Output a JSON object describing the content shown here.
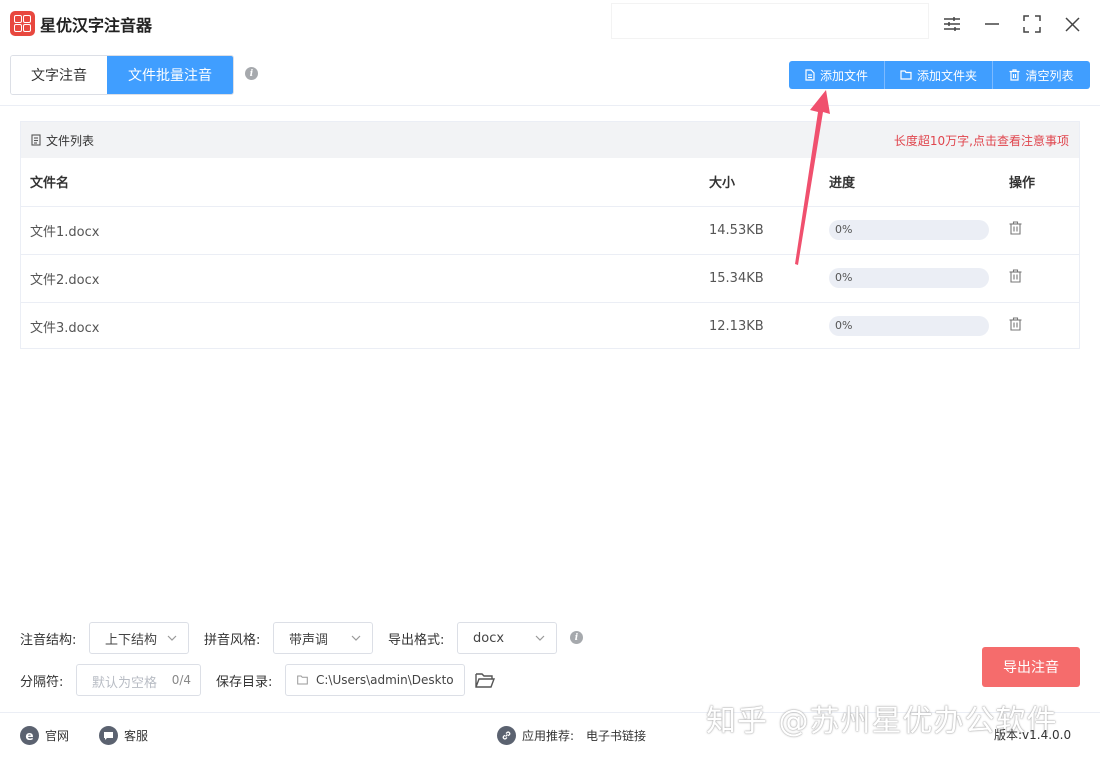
{
  "app": {
    "title": "星优汉字注音器"
  },
  "mode_tabs": [
    {
      "label": "文字注音",
      "active": false
    },
    {
      "label": "文件批量注音",
      "active": true
    }
  ],
  "toolbar": {
    "add_file": "添加文件",
    "add_folder": "添加文件夹",
    "clear_list": "清空列表"
  },
  "file_list": {
    "title": "文件列表",
    "note": "长度超10万字,点击查看注意事项",
    "columns": [
      "文件名",
      "大小",
      "进度",
      "操作"
    ],
    "rows": [
      {
        "name": "文件1.docx",
        "size": "14.53KB",
        "progress": "0%",
        "progress_value": 0
      },
      {
        "name": "文件2.docx",
        "size": "15.34KB",
        "progress": "0%",
        "progress_value": 0
      },
      {
        "name": "文件3.docx",
        "size": "12.13KB",
        "progress": "0%",
        "progress_value": 0
      }
    ]
  },
  "settings": {
    "structure_label": "注音结构:",
    "structure_value": "上下结构",
    "style_label": "拼音风格:",
    "style_value": "带声调",
    "format_label": "导出格式:",
    "format_value": "docx",
    "separator_label": "分隔符:",
    "separator_placeholder": "默认为空格",
    "separator_count": "0/4",
    "save_dir_label": "保存目录:",
    "save_dir_value": "C:\\Users\\admin\\Deskto"
  },
  "export_button": "导出注音",
  "footer": {
    "website": "官网",
    "service": "客服",
    "recommend_label": "应用推荐:",
    "recommend_link": "电子书链接",
    "version": "版本:v1.4.0.0"
  },
  "watermark": "知乎 @苏州星优办公软件",
  "colors": {
    "primary": "#409eff",
    "export": "#f56c6c",
    "note": "#e0454d",
    "arrow": "#f0506e"
  }
}
